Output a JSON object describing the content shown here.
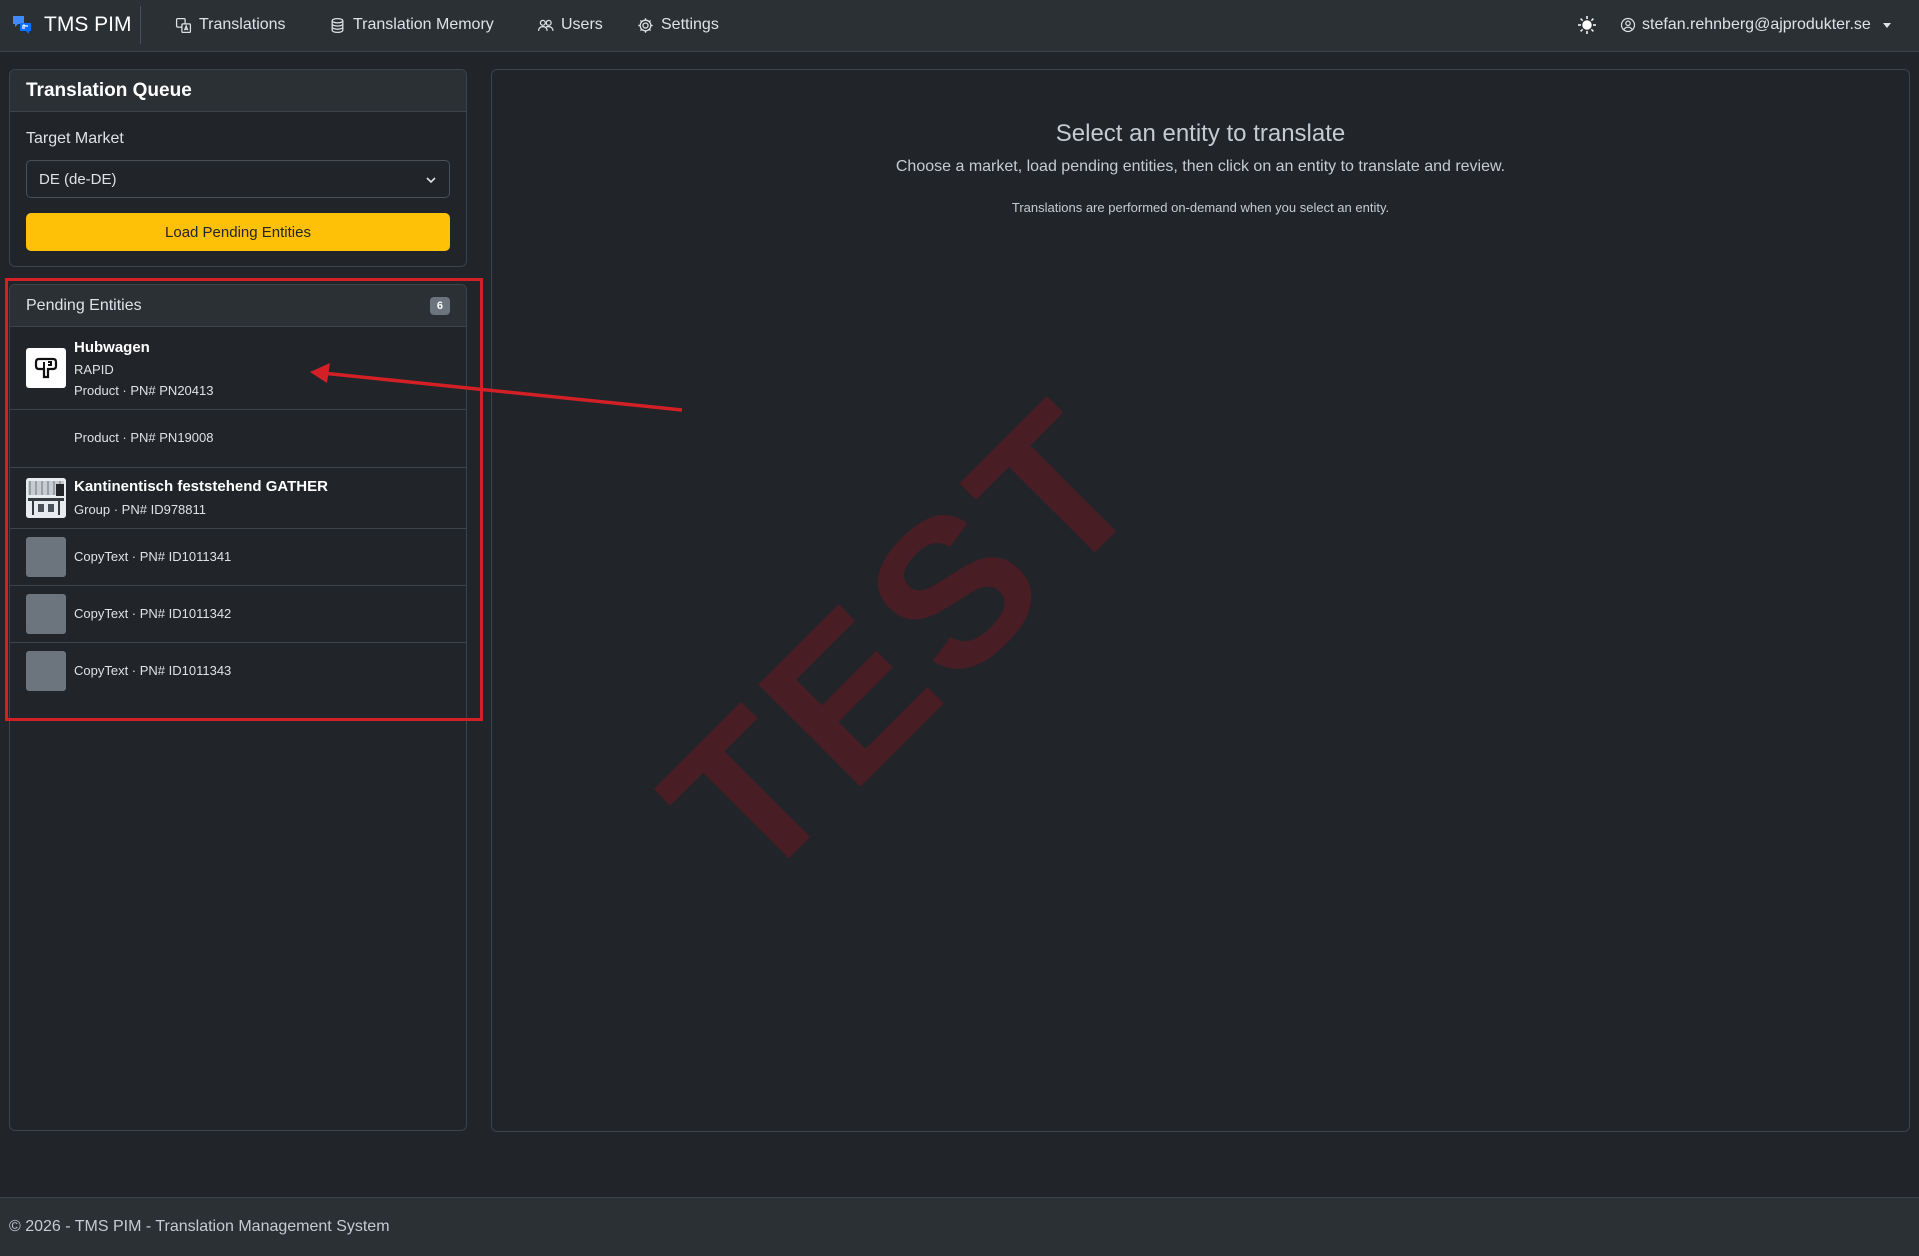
{
  "navbar": {
    "brand": "TMS PIM",
    "items": [
      {
        "label": "Translations",
        "icon": "translate-icon"
      },
      {
        "label": "Translation Memory",
        "icon": "database-icon"
      },
      {
        "label": "Users",
        "icon": "users-icon"
      },
      {
        "label": "Settings",
        "icon": "gear-icon"
      }
    ],
    "user_email": "stefan.rehnberg@ajprodukter.se"
  },
  "queue": {
    "title": "Translation Queue",
    "market_label": "Target Market",
    "market_value": "DE (de-DE)",
    "load_button": "Load Pending Entities"
  },
  "pending": {
    "title": "Pending Entities",
    "count": "6",
    "entities": [
      {
        "title": "Hubwagen",
        "brand": "RAPID",
        "meta": "Product · PN# PN20413",
        "thumb": "logo"
      },
      {
        "title": "",
        "brand": "",
        "meta": "Product · PN# PN19008",
        "thumb": "none"
      },
      {
        "title": "Kantinentisch feststehend GATHER",
        "brand": "",
        "meta": "Group · PN# ID978811",
        "thumb": "photo"
      },
      {
        "title": "",
        "brand": "",
        "meta": "CopyText · PN# ID1011341",
        "thumb": "gray"
      },
      {
        "title": "",
        "brand": "",
        "meta": "CopyText · PN# ID1011342",
        "thumb": "gray"
      },
      {
        "title": "",
        "brand": "",
        "meta": "CopyText · PN# ID1011343",
        "thumb": "gray"
      }
    ]
  },
  "main": {
    "title": "Select an entity to translate",
    "description": "Choose a market, load pending entities, then click on an entity to translate and review.",
    "note": "Translations are performed on-demand when you select an entity."
  },
  "watermark": "TEST",
  "footer": "© 2026 - TMS PIM - Translation Management System",
  "colors": {
    "accent": "#ffc107",
    "background": "#212529",
    "navbar": "#2b3035",
    "annotation": "#d31f26"
  }
}
